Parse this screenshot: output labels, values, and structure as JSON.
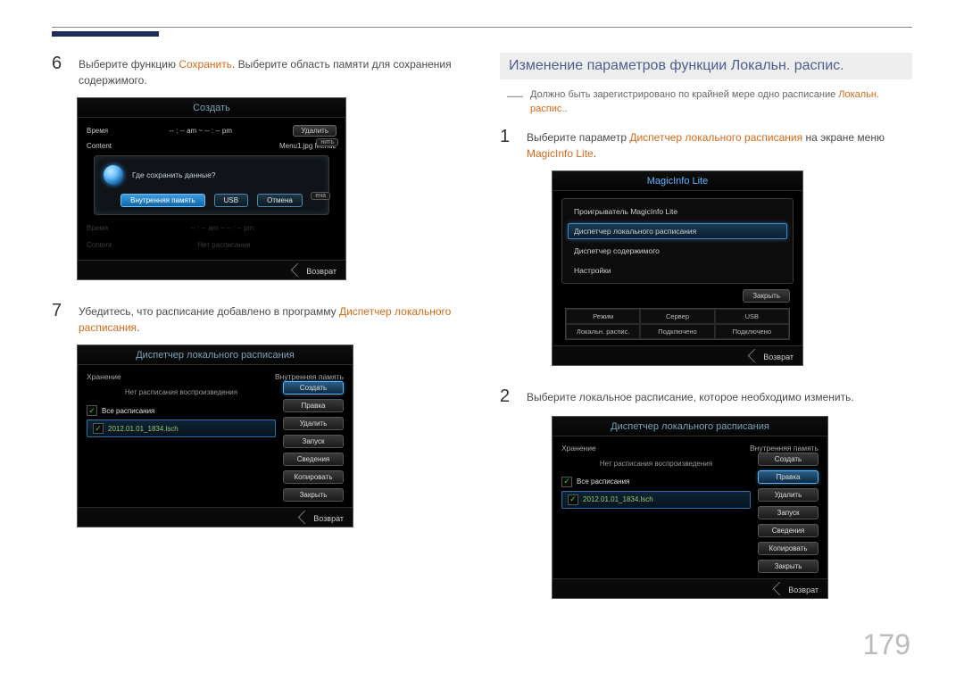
{
  "left": {
    "step6": {
      "num": "6",
      "pre": "Выберите функцию ",
      "hi": "Сохранить",
      "post": ". Выберите область памяти для сохранения содержимого."
    },
    "panelA": {
      "title": "Создать",
      "row_time_label": "Время",
      "row_time_ampm": "-- : -- am ~ -- : -- pm",
      "delete_btn": "Удалить",
      "row_content_label": "Content",
      "row_content_value": "Menu1.jpg  Menu2",
      "dialog_question": "Где сохранить данные?",
      "btn_internal": "Внутренняя память",
      "btn_usb": "USB",
      "btn_cancel": "Отмена",
      "ghost_time_label": "Время",
      "ghost_time_val": "-- : -- am ~ -- : -- pm",
      "ghost_content_label": "Content",
      "ghost_content_val": "Нет расписания",
      "overlay1": "нить",
      "overlay2": "ена",
      "return": "Возврат"
    },
    "step7": {
      "num": "7",
      "pre": "Убедитесь, что расписание добавлено в программу ",
      "hi": "Диспетчер локального расписания",
      "post": "."
    },
    "panelB": {
      "title": "Диспетчер локального расписания",
      "storage": "Хранение",
      "internal": "Внутренняя память",
      "empty": "Нет расписания воспроизведения",
      "all": "Все расписания",
      "file": "2012.01.01_1834.lsch",
      "btns": [
        "Создать",
        "Правка",
        "Удалить",
        "Запуск",
        "Сведения",
        "Копировать",
        "Закрыть"
      ],
      "hl_index": 0,
      "return": "Возврат"
    }
  },
  "right": {
    "section_title": "Изменение параметров функции Локальн. распис.",
    "note_pre": "Должно быть зарегистрировано по крайней мере одно расписание ",
    "note_hi": "Локальн. распис.",
    "note_post": ".",
    "step1": {
      "num": "1",
      "pre": "Выберите параметр ",
      "hi1": "Диспетчер локального расписания",
      "mid": " на экране меню ",
      "hi2": "MagicInfo Lite",
      "post": "."
    },
    "panelC": {
      "title": "MagicInfo Lite",
      "items": [
        "Проигрыватель MagicInfo Lite",
        "Диспетчер локального расписания",
        "Диспетчер содержимого",
        "Настройки"
      ],
      "sel_index": 1,
      "close": "Закрыть",
      "grid_row1": [
        "Режим",
        "Сервер",
        "USB"
      ],
      "grid_row2": [
        "Локальн. распис.",
        "Подключено",
        "Подключено"
      ],
      "return": "Возврат"
    },
    "step2": {
      "num": "2",
      "text": "Выберите локальное расписание, которое необходимо изменить."
    },
    "panelD": {
      "title": "Диспетчер локального расписания",
      "storage": "Хранение",
      "internal": "Внутренняя память",
      "empty": "Нет расписания воспроизведения",
      "all": "Все расписания",
      "file": "2012.01.01_1834.lsch",
      "btns": [
        "Создать",
        "Правка",
        "Удалить",
        "Запуск",
        "Сведения",
        "Копировать",
        "Закрыть"
      ],
      "hl_index": 1,
      "return": "Возврат"
    }
  },
  "page_number": "179"
}
